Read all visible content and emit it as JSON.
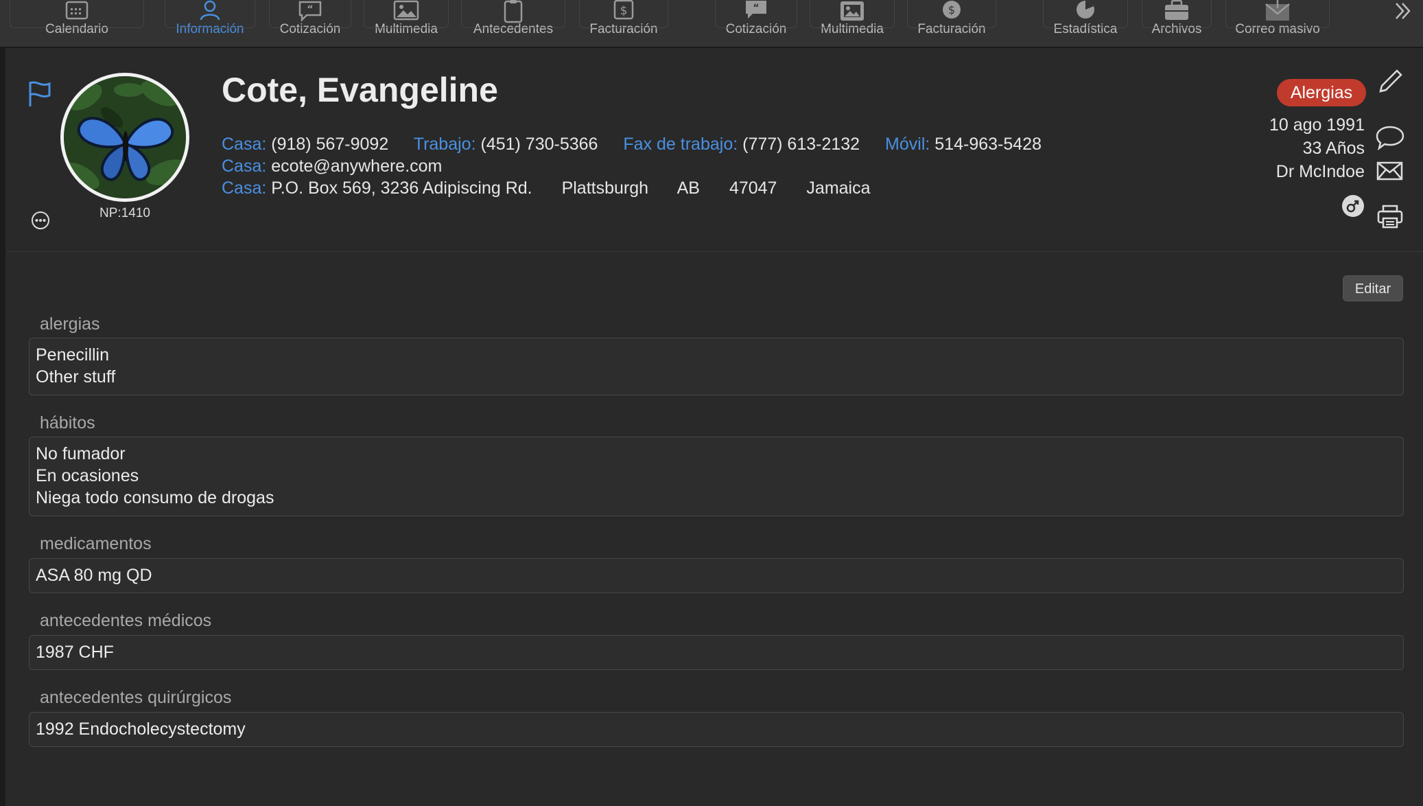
{
  "toolbar": {
    "items": [
      {
        "label": "Calendario",
        "icon": "calendar-icon"
      },
      {
        "label": "Información",
        "icon": "person-icon",
        "active": true
      },
      {
        "label": "Cotización",
        "icon": "quote-bubble-icon"
      },
      {
        "label": "Multimedia",
        "icon": "photo-icon"
      },
      {
        "label": "Antecedentes",
        "icon": "clipboard-icon"
      },
      {
        "label": "Facturación",
        "icon": "dollar-doc-icon"
      },
      {
        "label": "Cotización",
        "icon": "quote-bubble-icon"
      },
      {
        "label": "Multimedia",
        "icon": "photo-icon"
      },
      {
        "label": "Facturación",
        "icon": "dollar-circle-icon"
      },
      {
        "label": "Estadística",
        "icon": "pie-chart-icon"
      },
      {
        "label": "Archivos",
        "icon": "briefcase-icon"
      },
      {
        "label": "Correo masivo",
        "icon": "mass-mail-icon"
      }
    ],
    "overflow_icon": "double-chevron-right-icon",
    "active_color": "#4a90e2"
  },
  "patient": {
    "name": "Cote, Evangeline",
    "np": "NP:1410",
    "phones": {
      "home_label": "Casa:",
      "home": "(918) 567-9092",
      "work_label": "Trabajo:",
      "work": "(451) 730-5366",
      "workfax_label": "Fax de trabajo:",
      "workfax": "(777) 613-2132",
      "mobile_label": "Móvil:",
      "mobile": "514-963-5428"
    },
    "email": {
      "label": "Casa:",
      "value": "ecote@anywhere.com"
    },
    "address": {
      "label": "Casa:",
      "street": "P.O. Box 569, 3236 Adipiscing Rd.",
      "city": "Plattsburgh",
      "region": "AB",
      "postal": "47047",
      "country": "Jamaica"
    },
    "alert_badge": "Alergias",
    "birthdate": "10 ago 1991",
    "age": "33 Años",
    "doctor": "Dr McIndoe",
    "label_color": "#4a90e2",
    "alert_color": "#c13b2d"
  },
  "sections": {
    "edit_label": "Editar",
    "allergies": {
      "title": "alergias",
      "lines": [
        "Penecillin",
        "Other stuff"
      ]
    },
    "habits": {
      "title": "hábitos",
      "lines": [
        "No fumador",
        "En ocasiones",
        "Niega todo consumo de drogas"
      ]
    },
    "medications": {
      "title": "medicamentos",
      "lines": [
        "ASA 80 mg QD"
      ]
    },
    "medical_history": {
      "title": "antecedentes médicos",
      "lines": [
        "1987 CHF"
      ]
    },
    "surgical_history": {
      "title": "antecedentes quirúrgicos",
      "lines": [
        "1992 Endocholecystectomy"
      ]
    }
  }
}
